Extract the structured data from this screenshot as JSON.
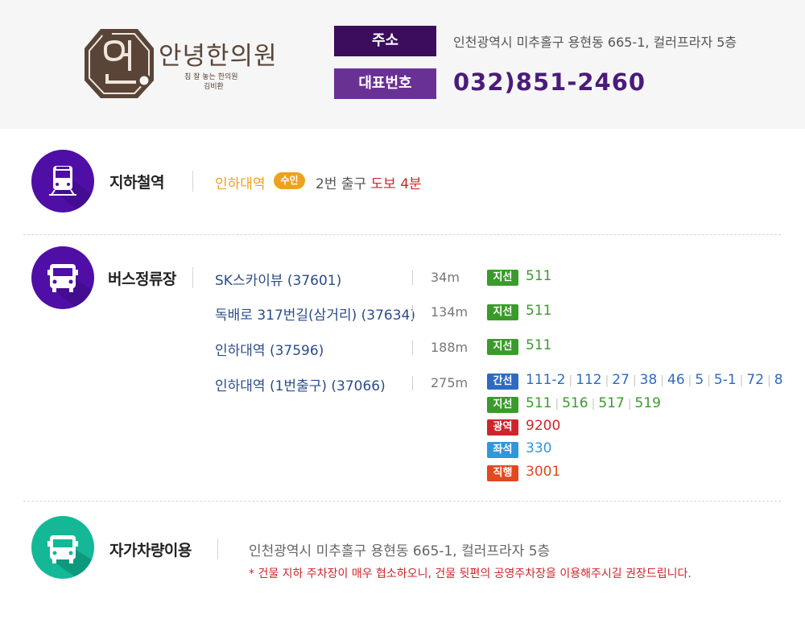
{
  "header": {
    "logo_name": "안녕한의원",
    "logo_tagline": "침 잘 놓는 한의원",
    "logo_doctor": "김비환",
    "address_label": "주소",
    "address": "인천광역시 미추홀구 용현동 665-1, 컬러프라자 5층",
    "phone_label": "대표번호",
    "phone": "032)851-2460",
    "colors": {
      "label_dark": "#3b0d5c",
      "label_light": "#6a3194",
      "logo_brown": "#5a4438"
    }
  },
  "subway": {
    "icon": "train-icon",
    "title": "지하철역",
    "station": "인하대역",
    "line": "수인",
    "exit_text": "2번 출구",
    "walk_text": "도보 4분",
    "line_color": "#f0a11c"
  },
  "bus": {
    "icon": "bus-icon",
    "title": "버스정류장",
    "stops": [
      {
        "name": "SK스카이뷰 (37601)",
        "distance": "34m"
      },
      {
        "name": "독배로 317번길(삼거리)  (37634)",
        "distance": "134m"
      },
      {
        "name": "인하대역 (37596)",
        "distance": "188m"
      },
      {
        "name": "인하대역 (1번출구) (37066)",
        "distance": "275m"
      }
    ],
    "routes": [
      {
        "type": "지선",
        "color": "#3a9b2b",
        "numbers": [
          "511"
        ]
      },
      {
        "type": "지선",
        "color": "#3a9b2b",
        "numbers": [
          "511"
        ]
      },
      {
        "type": "지선",
        "color": "#3a9b2b",
        "numbers": [
          "511"
        ]
      },
      {
        "type": "간선",
        "color": "#2e6ac4",
        "numbers": [
          "111-2",
          "112",
          "27",
          "38",
          "46",
          "5",
          "5-1",
          "72",
          "8"
        ]
      },
      {
        "type": "지선",
        "color": "#3a9b2b",
        "numbers": [
          "511",
          "516",
          "517",
          "519"
        ]
      },
      {
        "type": "광역",
        "color": "#d0242b",
        "numbers": [
          "9200"
        ]
      },
      {
        "type": "좌석",
        "color": "#3097d8",
        "numbers": [
          "330"
        ]
      },
      {
        "type": "직행",
        "color": "#e04a1e",
        "numbers": [
          "3001"
        ]
      }
    ]
  },
  "car": {
    "icon": "car-icon",
    "title": "자가차량이용",
    "address": "인천광역시 미추홀구 용현동 665-1, 컬러프라자 5층",
    "note": "* 건물 지하 주차장이 매우 협소하오니, 건물 뒷편의 공영주차장을 이용해주시길 권장드립니다."
  }
}
